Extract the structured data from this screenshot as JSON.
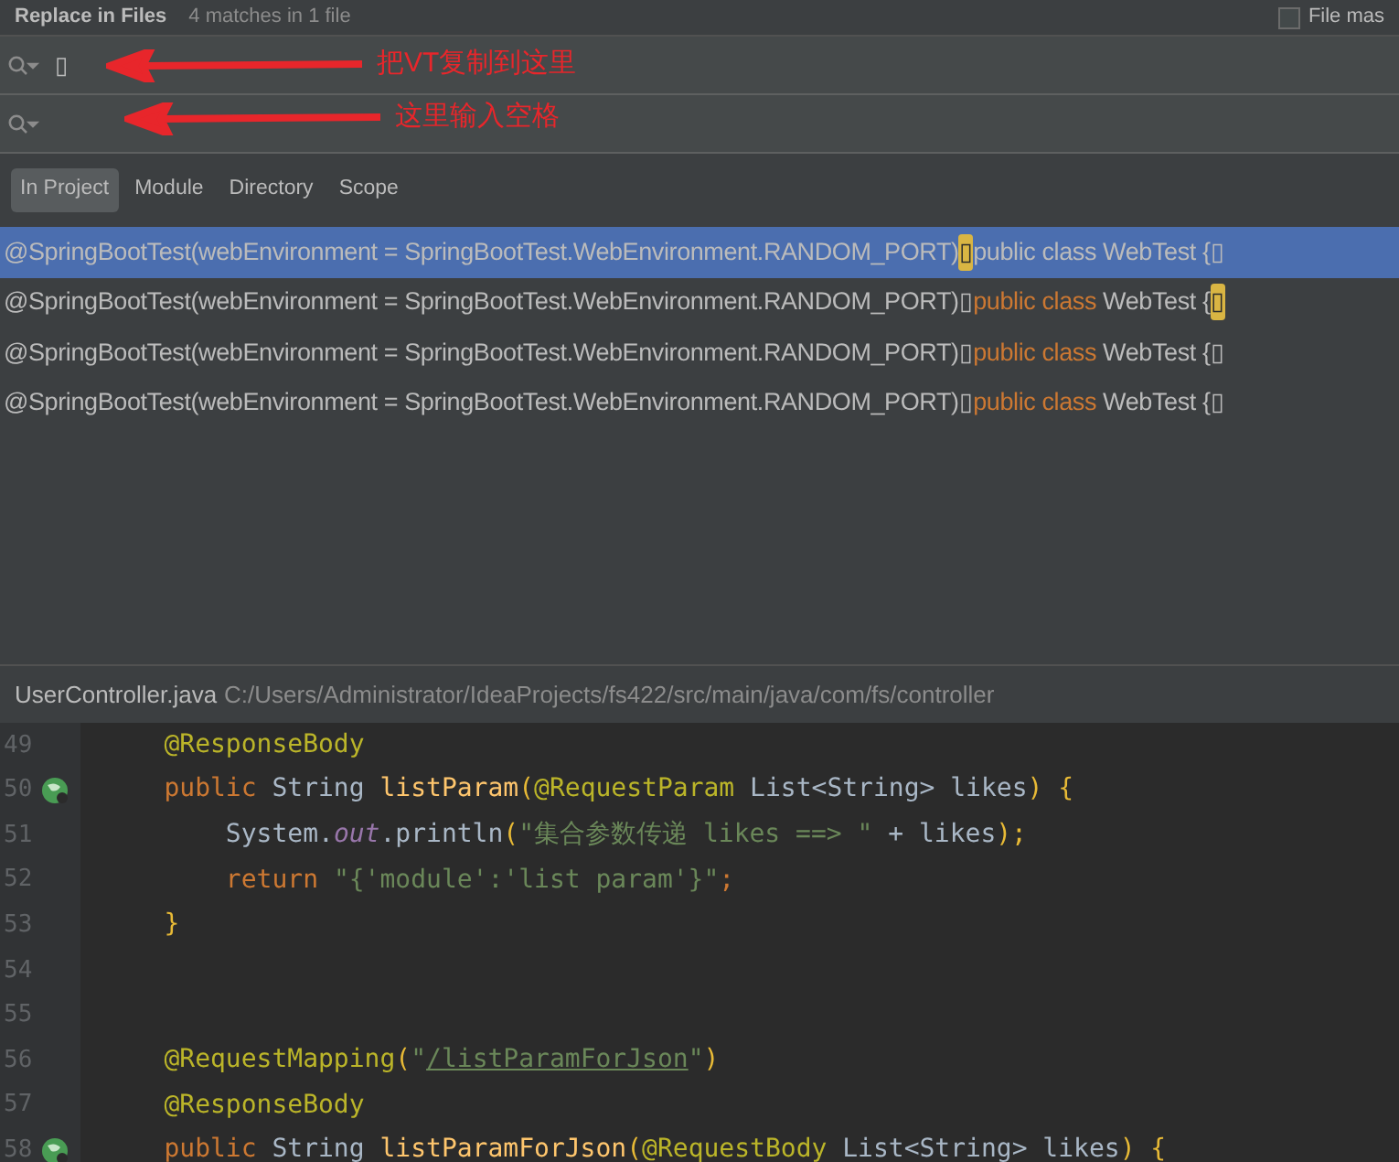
{
  "header": {
    "title": "Replace in Files",
    "subtitle": "4 matches in 1 file",
    "file_mask": {
      "label": "File mas",
      "checked": false
    }
  },
  "find_field": {
    "value": "▯",
    "annotation": "把VT复制到这里"
  },
  "replace_field": {
    "annotation": "这里输入空格"
  },
  "scopes": [
    {
      "label": "In Project",
      "selected": true
    },
    {
      "label": "Module",
      "selected": false
    },
    {
      "label": "Directory",
      "selected": false
    },
    {
      "label": "Scope",
      "selected": false
    }
  ],
  "results": [
    {
      "selected": true,
      "segments": [
        {
          "kind": "plain",
          "text": "@SpringBootTest(webEnvironment = SpringBootTest.WebEnvironment.RANDOM_PORT)"
        },
        {
          "kind": "match",
          "text": "▯"
        },
        {
          "kind": "plain",
          "text": "public class WebTest {▯"
        }
      ]
    },
    {
      "selected": false,
      "segments": [
        {
          "kind": "plain",
          "text": "@SpringBootTest(webEnvironment = SpringBootTest.WebEnvironment.RANDOM_PORT)▯"
        },
        {
          "kind": "keyword",
          "text": "public class"
        },
        {
          "kind": "plain",
          "text": " WebTest {"
        },
        {
          "kind": "match",
          "text": "▯"
        }
      ]
    },
    {
      "selected": false,
      "segments": [
        {
          "kind": "plain",
          "text": "@SpringBootTest(webEnvironment = SpringBootTest.WebEnvironment.RANDOM_PORT)▯"
        },
        {
          "kind": "keyword",
          "text": "public class"
        },
        {
          "kind": "plain",
          "text": " WebTest {▯"
        }
      ]
    },
    {
      "selected": false,
      "segments": [
        {
          "kind": "plain",
          "text": "@SpringBootTest(webEnvironment = SpringBootTest.WebEnvironment.RANDOM_PORT)▯"
        },
        {
          "kind": "keyword",
          "text": "public class"
        },
        {
          "kind": "plain",
          "text": " WebTest {▯"
        }
      ]
    }
  ],
  "file_bar": {
    "file": "UserController.java",
    "path": "C:/Users/Administrator/IdeaProjects/fs422/src/main/java/com/fs/controller"
  },
  "code": [
    {
      "number": "49",
      "gutter_icon": false,
      "tokens": [
        {
          "kind": "annotation",
          "text": "    @ResponseBody"
        }
      ]
    },
    {
      "number": "50",
      "gutter_icon": true,
      "tokens": [
        {
          "kind": "keyword",
          "text": "    public "
        },
        {
          "kind": "plain",
          "text": "String "
        },
        {
          "kind": "method",
          "text": "listParam"
        },
        {
          "kind": "brace",
          "text": "("
        },
        {
          "kind": "annotation",
          "text": "@RequestParam "
        },
        {
          "kind": "plain",
          "text": "List<String> likes"
        },
        {
          "kind": "brace",
          "text": ") {"
        }
      ]
    },
    {
      "number": "51",
      "gutter_icon": false,
      "tokens": [
        {
          "kind": "plain",
          "text": "        System."
        },
        {
          "kind": "field",
          "text": "out"
        },
        {
          "kind": "plain",
          "text": ".println"
        },
        {
          "kind": "brace",
          "text": "("
        },
        {
          "kind": "string",
          "text": "\"集合参数传递 likes ==> \""
        },
        {
          "kind": "plain",
          "text": " + likes"
        },
        {
          "kind": "brace",
          "text": ");"
        }
      ]
    },
    {
      "number": "52",
      "gutter_icon": false,
      "tokens": [
        {
          "kind": "keyword",
          "text": "        return "
        },
        {
          "kind": "string",
          "text": "\"{'module':'list param'}\""
        },
        {
          "kind": "keyword",
          "text": ";"
        }
      ]
    },
    {
      "number": "53",
      "gutter_icon": false,
      "tokens": [
        {
          "kind": "brace",
          "text": "    }"
        }
      ]
    },
    {
      "number": "54",
      "gutter_icon": false
    },
    {
      "number": "55",
      "gutter_icon": false
    },
    {
      "number": "56",
      "gutter_icon": false,
      "tokens": [
        {
          "kind": "annotation",
          "text": "    @RequestMapping"
        },
        {
          "kind": "brace",
          "text": "("
        },
        {
          "kind": "string",
          "text": "\""
        },
        {
          "kind": "link",
          "text": "/listParamForJson"
        },
        {
          "kind": "string",
          "text": "\""
        },
        {
          "kind": "brace",
          "text": ")"
        }
      ]
    },
    {
      "number": "57",
      "gutter_icon": false,
      "tokens": [
        {
          "kind": "annotation",
          "text": "    @ResponseBody"
        }
      ]
    },
    {
      "number": "58",
      "gutter_icon": true,
      "tokens": [
        {
          "kind": "keyword",
          "text": "    public "
        },
        {
          "kind": "plain",
          "text": "String "
        },
        {
          "kind": "method",
          "text": "listParamForJson"
        },
        {
          "kind": "brace",
          "text": "("
        },
        {
          "kind": "annotation",
          "text": "@RequestBody "
        },
        {
          "kind": "plain",
          "text": "List<String> likes"
        },
        {
          "kind": "brace",
          "text": ") {"
        }
      ]
    }
  ]
}
